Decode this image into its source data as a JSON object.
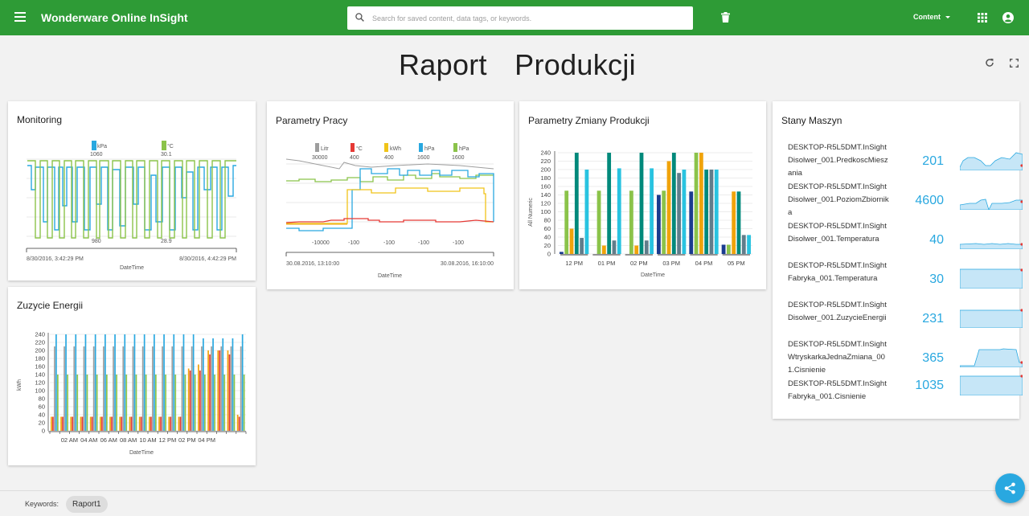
{
  "app": {
    "title": "Wonderware Online InSight",
    "search_placeholder": "Search for saved content, data tags, or keywords.",
    "content_menu": "Content",
    "icons": [
      "menu-icon",
      "search-icon",
      "trash-icon",
      "apps-icon",
      "account-icon",
      "refresh-icon",
      "fullscreen-icon",
      "share-icon"
    ]
  },
  "page": {
    "title": "Raport Produkcji"
  },
  "colors": {
    "topbar": "#2e9b36",
    "blue": "#29a8e0",
    "green": "#8bc34a",
    "orange": "#f0a30a",
    "red": "#e53935",
    "gray": "#9e9e9e",
    "teal": "#00897b",
    "navy": "#1a3c8f",
    "slate": "#607d8b"
  },
  "cards": {
    "monitoring": {
      "title": "Monitoring",
      "xlabel": "DateTime",
      "x_start": "8/30/2016, 3:42:29 PM",
      "x_end": "8/30/2016, 4:42:29 PM",
      "legend": [
        {
          "unit": "kPa",
          "top": "1060",
          "bottom": "980",
          "color": "#29a8e0"
        },
        {
          "unit": "°C",
          "top": "30.1",
          "bottom": "28.9",
          "color": "#8bc34a"
        }
      ]
    },
    "parametry_pracy": {
      "title": "Parametry Pracy",
      "xlabel": "DateTime",
      "x_start": "30.08.2016, 13:10:00",
      "x_end": "30.08.2016, 16:10:00",
      "legend": [
        {
          "unit": "Litr",
          "top": "30000",
          "bottom": "-10000",
          "color": "#9e9e9e"
        },
        {
          "unit": "°C",
          "top": "400",
          "bottom": "-100",
          "color": "#e53935"
        },
        {
          "unit": "kWh",
          "top": "400",
          "bottom": "-100",
          "color": "#f0c419"
        },
        {
          "unit": "hPa",
          "top": "1600",
          "bottom": "-100",
          "color": "#29a8e0"
        },
        {
          "unit": "hPa",
          "top": "1600",
          "bottom": "-100",
          "color": "#8bc34a"
        }
      ]
    },
    "parametry_zmiany": {
      "title": "Parametry Zmiany Produkcji",
      "xlabel": "DateTime",
      "ylabel": "All Numeric"
    },
    "zuzycie": {
      "title": "Zuzycie Energii",
      "xlabel": "DateTime",
      "ylabel": "kWh"
    },
    "stany": {
      "title": "Stany Maszyn",
      "rows": [
        {
          "name": "DESKTOP-R5L5DMT.InSightDisolwer_001.PredkoscMieszania",
          "value": "201"
        },
        {
          "name": "DESKTOP-R5L5DMT.InSightDisolwer_001.PoziomZbiornika",
          "value": "4600"
        },
        {
          "name": "DESKTOP-R5L5DMT.InSightDisolwer_001.Temperatura",
          "value": "40"
        },
        {
          "name": "DESKTOP-R5L5DMT.InSightFabryka_001.Temperatura",
          "value": "30"
        },
        {
          "name": "DESKTOP-R5L5DMT.InSightDisolwer_001.ZuzycieEnergii",
          "value": "231"
        },
        {
          "name": "DESKTOP-R5L5DMT.InSightWtryskarkaJednaZmiana_001.Cisnienie",
          "value": "365"
        },
        {
          "name": "DESKTOP-R5L5DMT.InSightFabryka_001.Cisnienie",
          "value": "1035"
        }
      ]
    }
  },
  "footer": {
    "keywords_label": "Keywords:",
    "keyword": "Raport1"
  },
  "chart_data": [
    {
      "type": "bar",
      "chart": "Parametry Zmiany Produkcji",
      "xlabel": "DateTime",
      "ylabel": "All Numeric",
      "ylim": [
        0,
        240
      ],
      "yticks": [
        0,
        20,
        40,
        60,
        80,
        100,
        120,
        140,
        160,
        180,
        200,
        220,
        240
      ],
      "categories": [
        "12 PM",
        "01 PM",
        "02 PM",
        "03 PM",
        "04 PM",
        "05 PM"
      ],
      "series": [
        {
          "color": "#1a3c8f",
          "values": [
            5,
            0,
            0,
            140,
            148,
            22
          ]
        },
        {
          "color": "#8bc34a",
          "values": [
            150,
            150,
            150,
            150,
            240,
            22
          ]
        },
        {
          "color": "#f0a30a",
          "values": [
            60,
            20,
            20,
            220,
            240,
            148
          ]
        },
        {
          "color": "#00897b",
          "values": [
            240,
            240,
            240,
            240,
            200,
            148
          ]
        },
        {
          "color": "#607d8b",
          "values": [
            38,
            32,
            32,
            192,
            200,
            45
          ]
        },
        {
          "color": "#29c3e0",
          "values": [
            200,
            203,
            203,
            200,
            200,
            45
          ]
        }
      ]
    },
    {
      "type": "bar",
      "chart": "Zuzycie Energii",
      "xlabel": "DateTime",
      "ylabel": "kWh",
      "ylim": [
        0,
        240
      ],
      "yticks": [
        0,
        20,
        40,
        60,
        80,
        100,
        120,
        140,
        160,
        180,
        200,
        220,
        240
      ],
      "xticks": [
        "02 AM",
        "04 AM",
        "06 AM",
        "08 AM",
        "10 AM",
        "12 PM",
        "02 PM",
        "04 PM"
      ],
      "groups": 20,
      "series": [
        {
          "color": "#f0a30a",
          "values": [
            35,
            35,
            35,
            35,
            35,
            35,
            35,
            35,
            35,
            35,
            35,
            35,
            35,
            35,
            155,
            165,
            200,
            200,
            200,
            40
          ]
        },
        {
          "color": "#e53935",
          "values": [
            35,
            35,
            35,
            35,
            35,
            35,
            35,
            35,
            35,
            35,
            35,
            35,
            35,
            35,
            150,
            150,
            190,
            200,
            190,
            35
          ]
        },
        {
          "color": "#9e9e9e",
          "values": [
            210,
            210,
            210,
            210,
            210,
            210,
            210,
            210,
            210,
            210,
            210,
            210,
            210,
            210,
            210,
            210,
            210,
            210,
            210,
            210
          ]
        },
        {
          "color": "#29a8e0",
          "values": [
            240,
            240,
            240,
            240,
            240,
            240,
            240,
            240,
            240,
            240,
            240,
            240,
            240,
            240,
            240,
            230,
            230,
            230,
            230,
            240
          ]
        },
        {
          "color": "#8bc34a",
          "values": [
            140,
            140,
            140,
            140,
            140,
            140,
            140,
            140,
            140,
            140,
            140,
            140,
            140,
            140,
            140,
            140,
            140,
            140,
            140,
            140
          ]
        }
      ]
    }
  ]
}
